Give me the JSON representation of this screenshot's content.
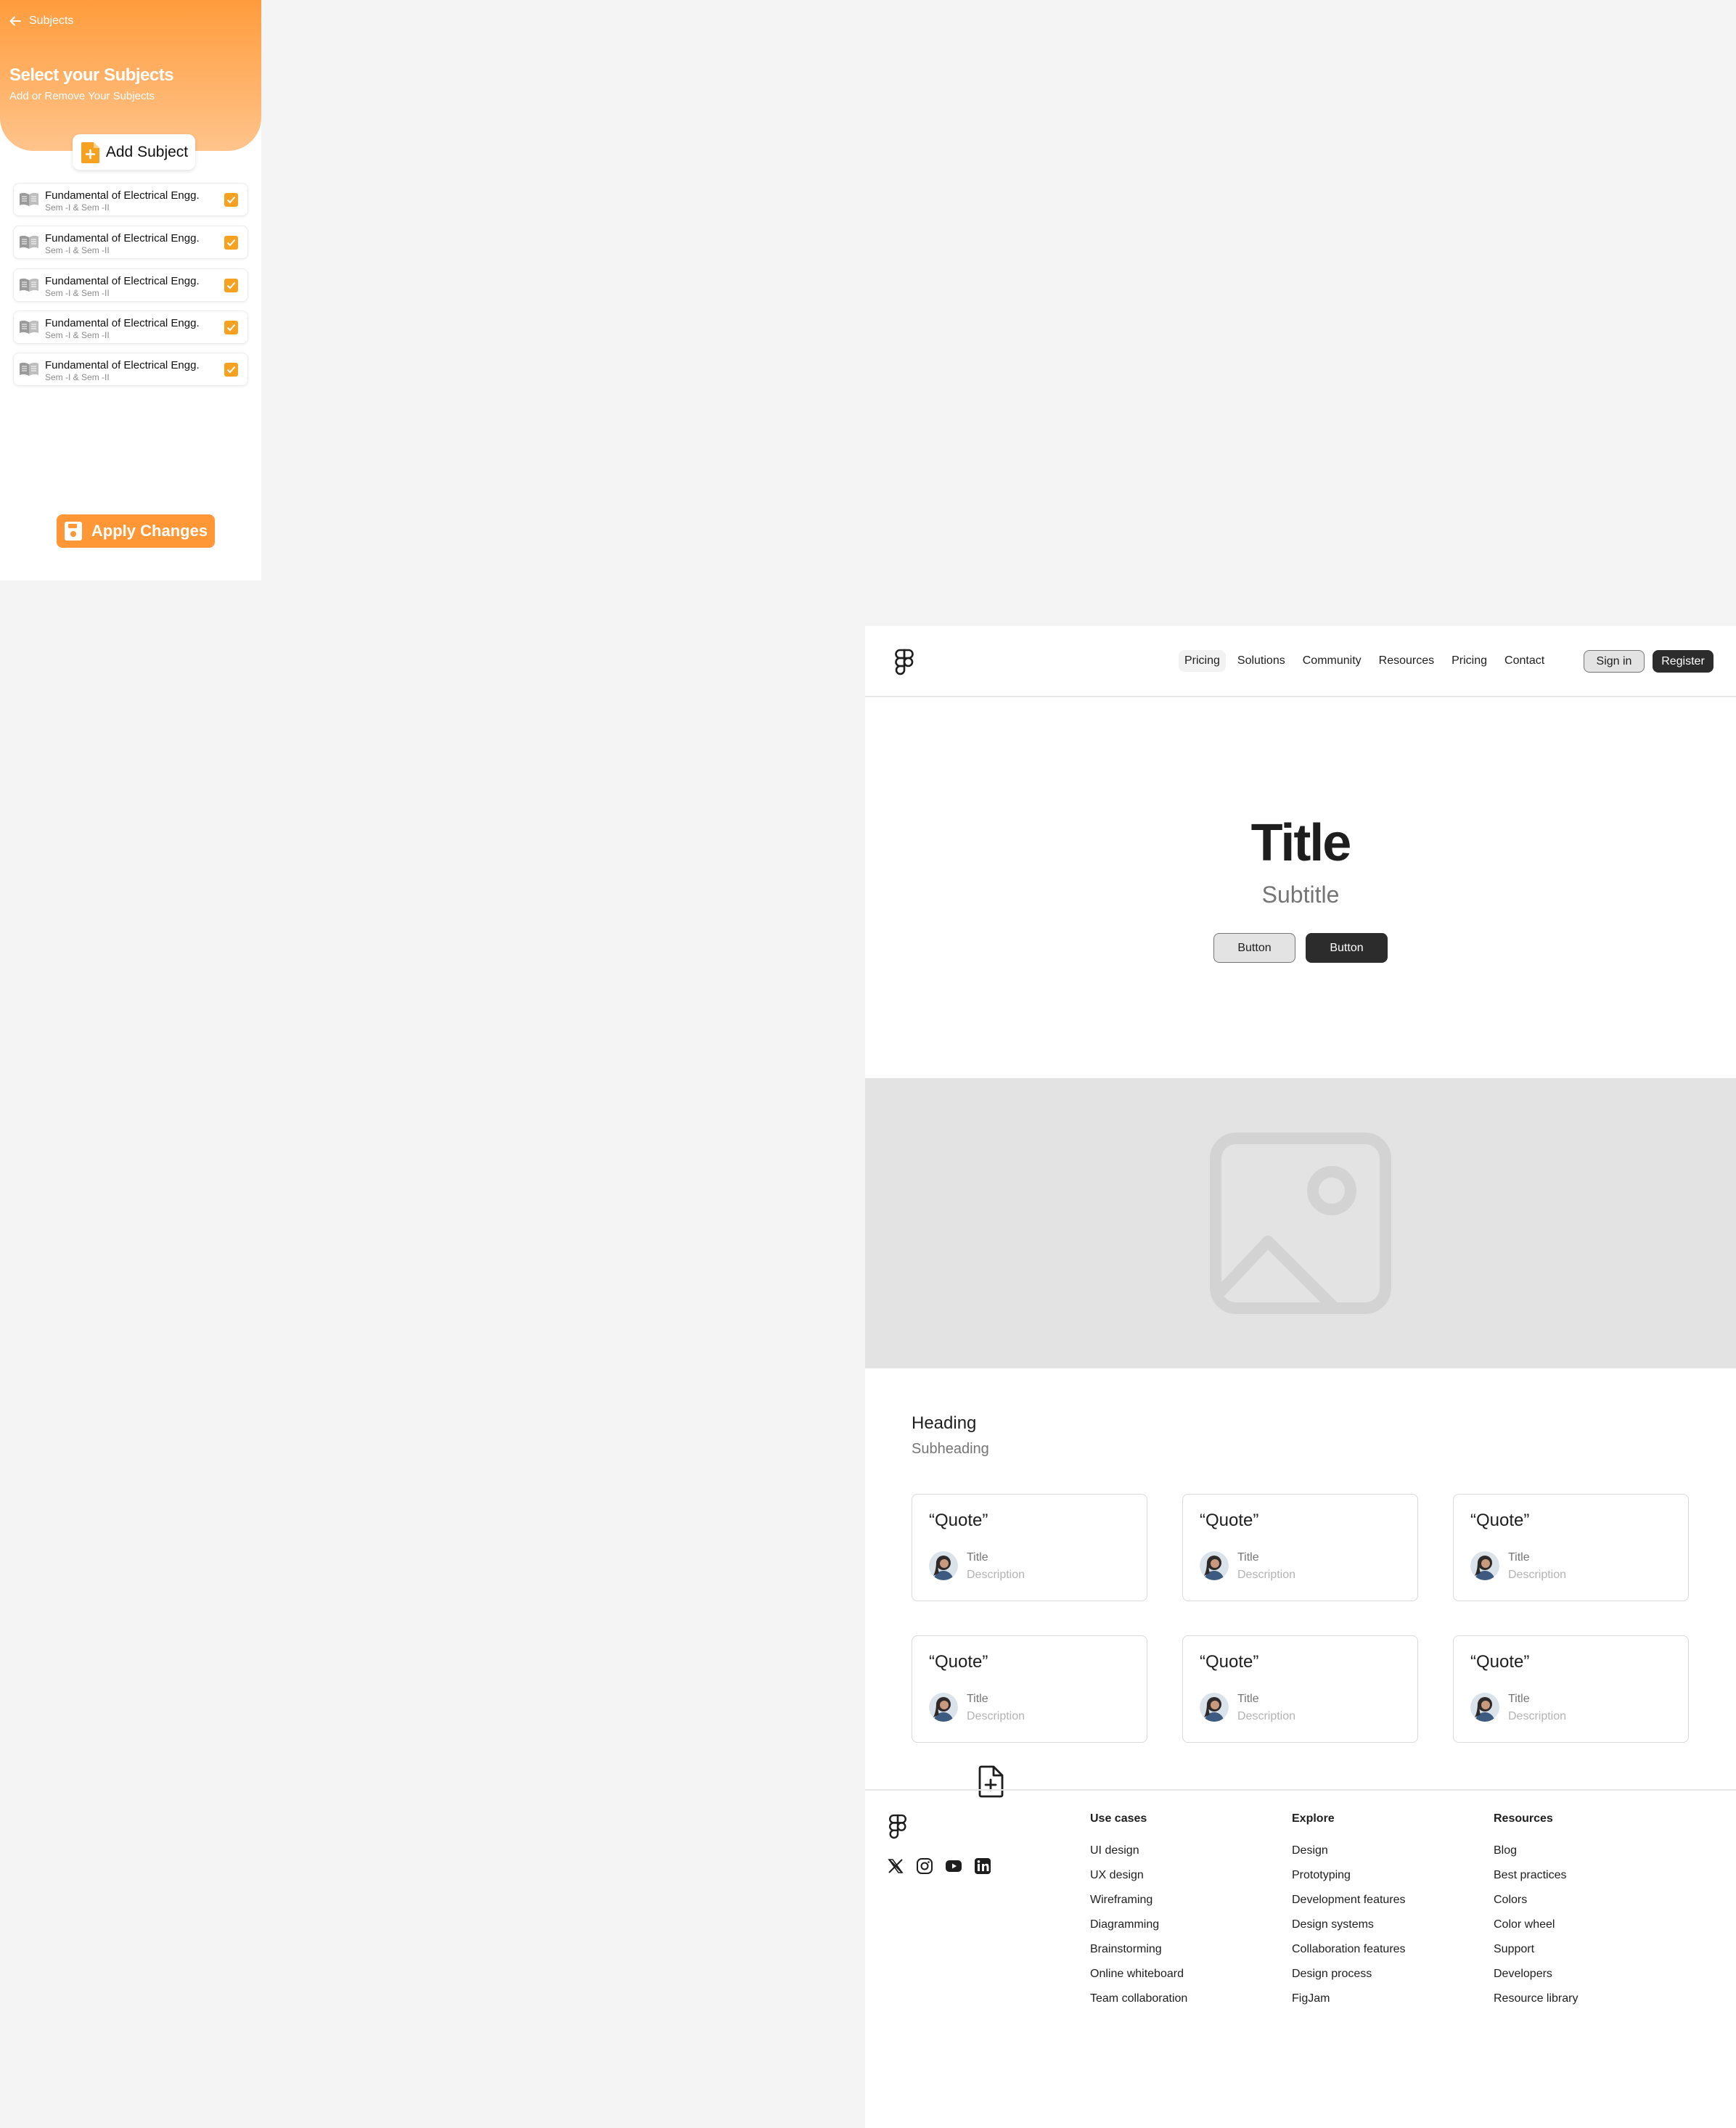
{
  "mobile": {
    "back_label": "Subjects",
    "title": "Select your Subjects",
    "subtitle": "Add or Remove Your Subjects",
    "add_button": "Add Subject",
    "subjects": [
      {
        "name": "Fundamental of Electrical Engg.",
        "sem": "Sem -I & Sem -II",
        "checked": true
      },
      {
        "name": "Fundamental of Electrical Engg.",
        "sem": "Sem -I & Sem -II",
        "checked": true
      },
      {
        "name": "Fundamental of Electrical Engg.",
        "sem": "Sem -I & Sem -II",
        "checked": true
      },
      {
        "name": "Fundamental of Electrical Engg.",
        "sem": "Sem -I & Sem -II",
        "checked": true
      },
      {
        "name": "Fundamental of Electrical Engg.",
        "sem": "Sem -I & Sem -II",
        "checked": true
      }
    ],
    "apply_button": "Apply Changes",
    "accent_color": "#ff9736"
  },
  "site": {
    "nav": {
      "links": [
        "Pricing",
        "Solutions",
        "Community",
        "Resources",
        "Pricing",
        "Contact"
      ],
      "sign_in": "Sign in",
      "register": "Register"
    },
    "hero": {
      "title": "Title",
      "subtitle": "Subtitle",
      "button_secondary": "Button",
      "button_primary": "Button"
    },
    "section": {
      "heading": "Heading",
      "subheading": "Subheading"
    },
    "testimonials": [
      {
        "quote": "“Quote”",
        "title": "Title",
        "description": "Description"
      },
      {
        "quote": "“Quote”",
        "title": "Title",
        "description": "Description"
      },
      {
        "quote": "“Quote”",
        "title": "Title",
        "description": "Description"
      },
      {
        "quote": "“Quote”",
        "title": "Title",
        "description": "Description"
      },
      {
        "quote": "“Quote”",
        "title": "Title",
        "description": "Description"
      },
      {
        "quote": "“Quote”",
        "title": "Title",
        "description": "Description"
      }
    ],
    "footer": {
      "socials": [
        "x-icon",
        "instagram-icon",
        "youtube-icon",
        "linkedin-icon"
      ],
      "columns": [
        {
          "heading": "Use cases",
          "items": [
            "UI design",
            "UX design",
            "Wireframing",
            "Diagramming",
            "Brainstorming",
            "Online whiteboard",
            "Team collaboration"
          ]
        },
        {
          "heading": "Explore",
          "items": [
            "Design",
            "Prototyping",
            "Development features",
            "Design systems",
            "Collaboration features",
            "Design process",
            "FigJam"
          ]
        },
        {
          "heading": "Resources",
          "items": [
            "Blog",
            "Best practices",
            "Colors",
            "Color wheel",
            "Support",
            "Developers",
            "Resource library"
          ]
        }
      ]
    }
  }
}
